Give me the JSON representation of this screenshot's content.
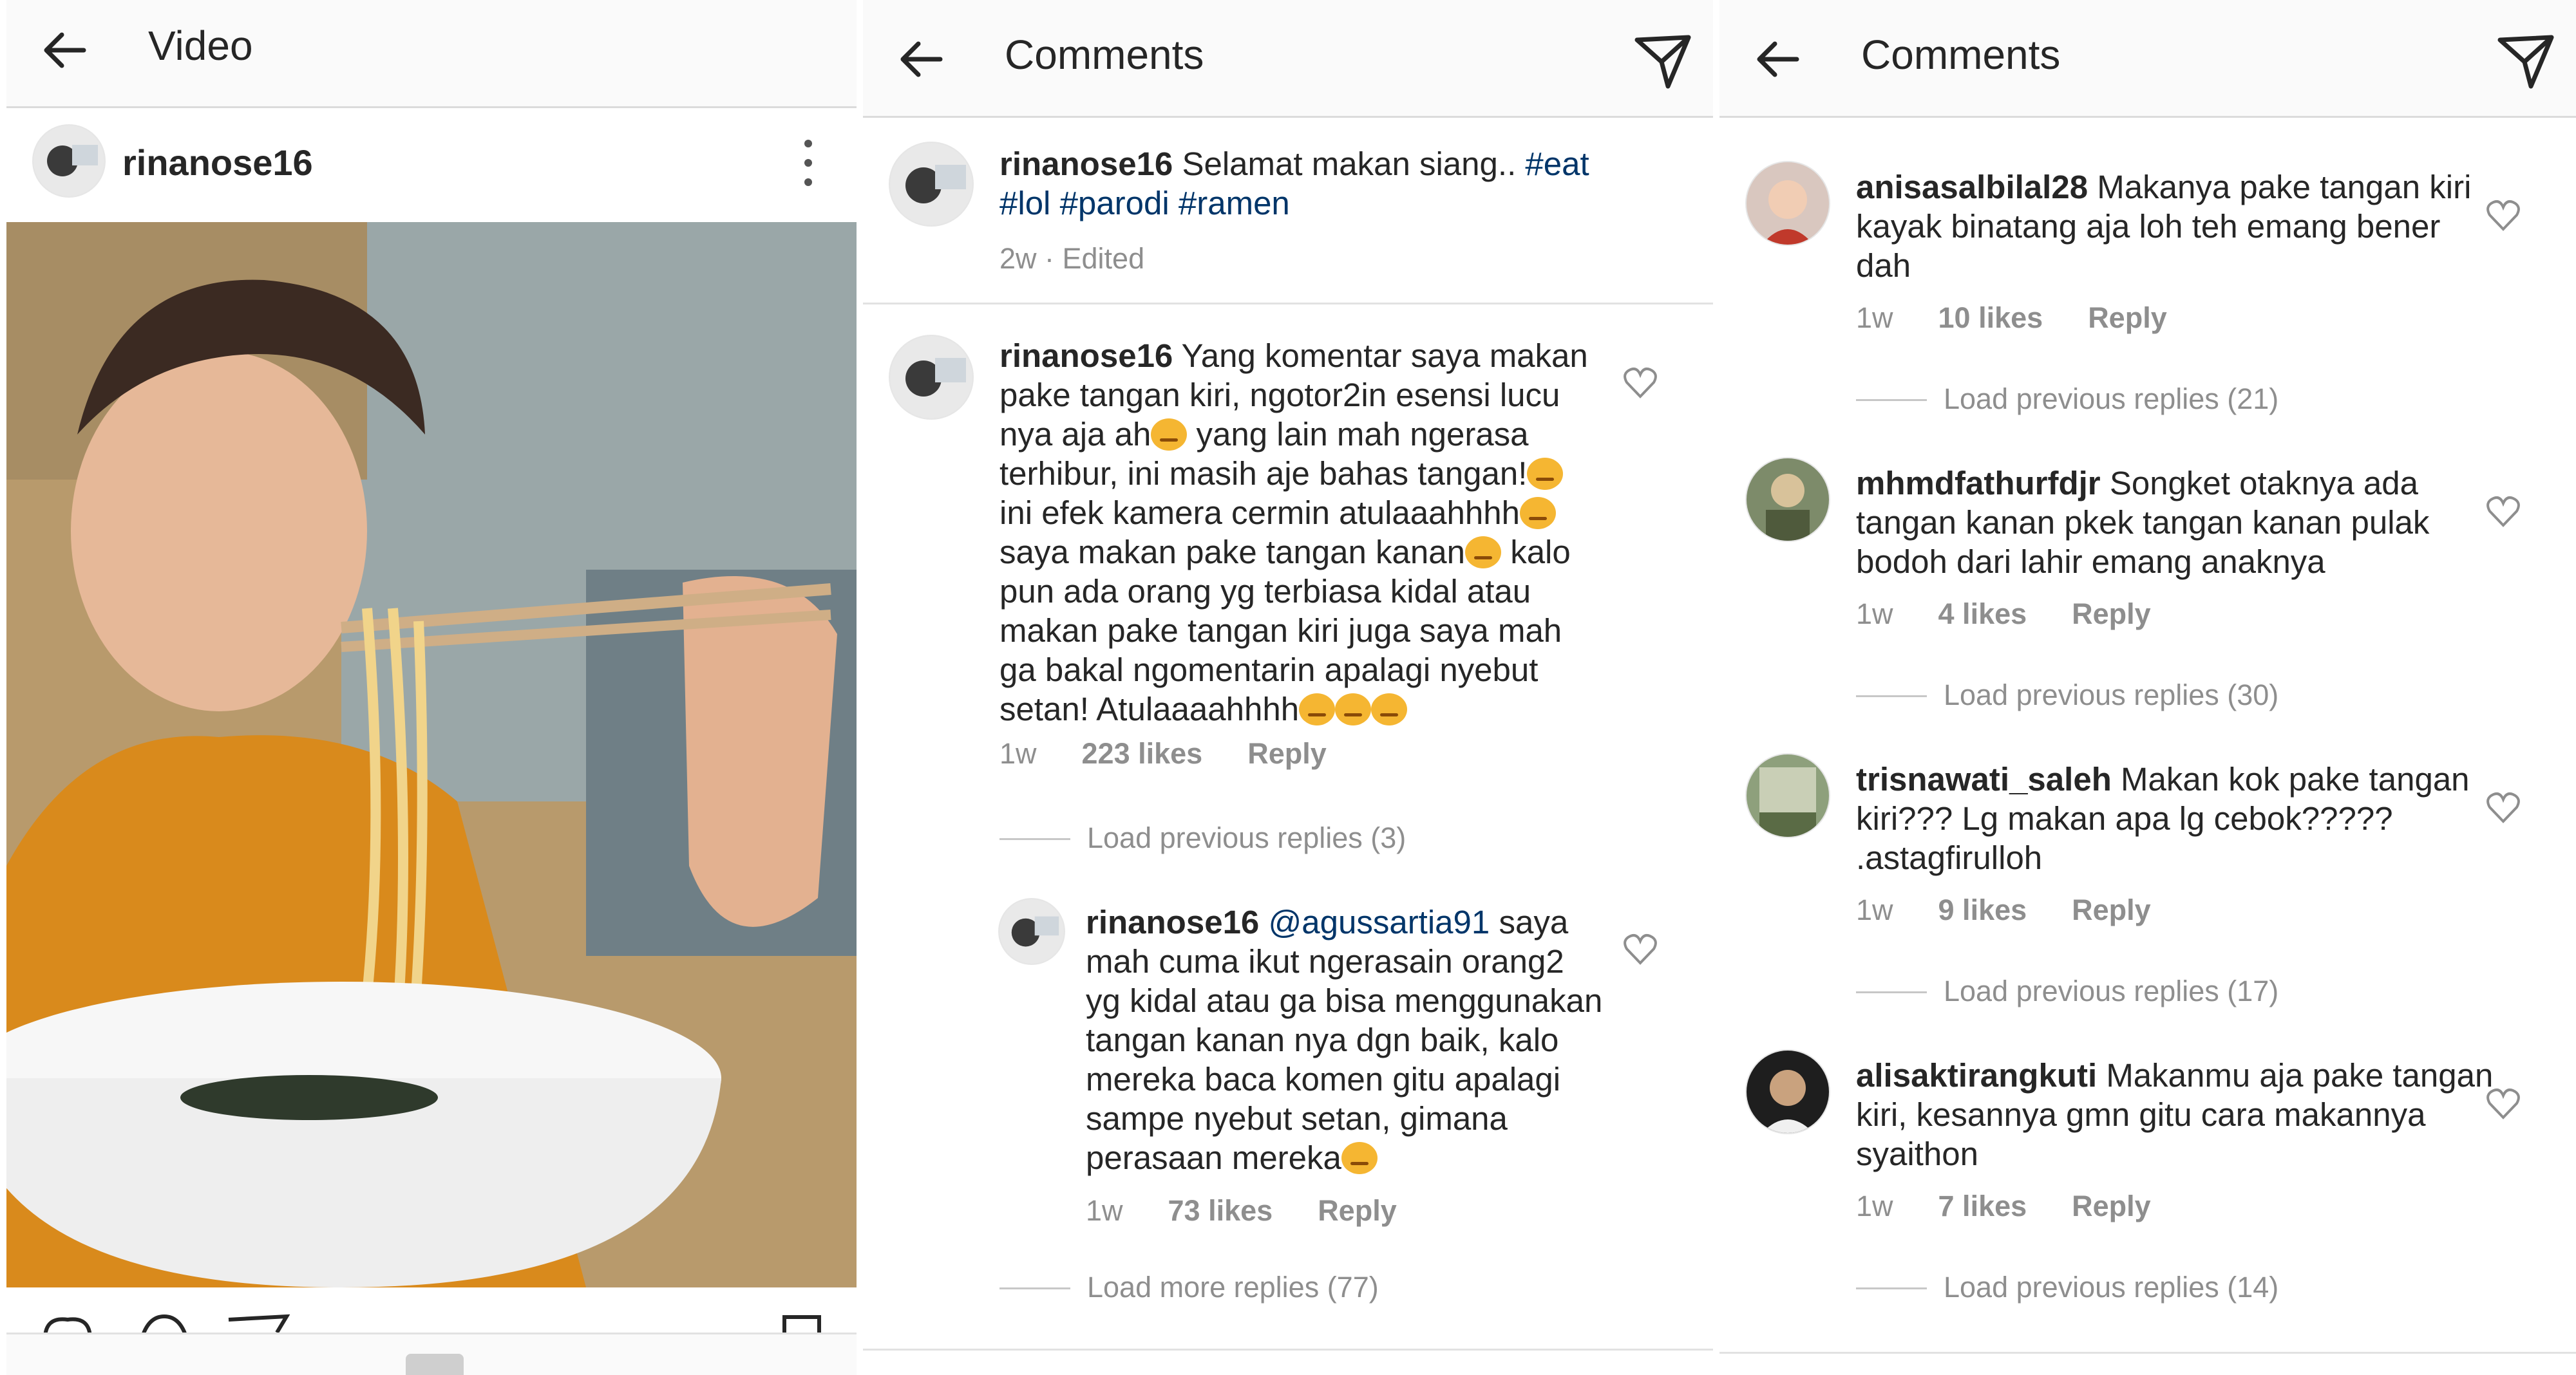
{
  "panel1": {
    "title": "Video",
    "post_user": "rinanose16"
  },
  "panel2": {
    "title": "Comments",
    "caption": {
      "user": "rinanose16",
      "text": "Selamat makan siang..",
      "hashtags": [
        "#eat",
        "#lol",
        "#parodi",
        "#ramen"
      ],
      "meta": "2w · Edited"
    },
    "comment1": {
      "user": "rinanose16",
      "lines": [
        "Yang komentar saya makan",
        "pake tangan kiri, ngotor2in esensi lucu",
        "nya aja ah",
        "yang lain mah ngerasa",
        "terhibur, ini masih aje bahas tangan!",
        "ini efek kamera cermin atulaaahhhh",
        "saya makan pake tangan kanan",
        "kalo",
        "pun ada orang yg terbiasa kidal atau",
        "makan pake tangan kiri juga saya mah",
        "ga bakal ngomentarin apalagi nyebut",
        "setan! Atulaaaahhhh"
      ],
      "time": "1w",
      "likes": "223 likes",
      "reply": "Reply"
    },
    "load_prev": "Load previous replies (3)",
    "reply1": {
      "user": "rinanose16",
      "mention": "@agussartia91",
      "lines": [
        "saya",
        "mah cuma ikut ngerasain orang2",
        "yg kidal atau ga bisa menggunakan",
        "tangan kanan nya dgn baik, kalo",
        "mereka baca komen gitu apalagi",
        "sampe nyebut setan, gimana",
        "perasaan mereka"
      ],
      "time": "1w",
      "likes": "73 likes",
      "reply": "Reply"
    },
    "load_more": "Load more replies (77)"
  },
  "panel3": {
    "title": "Comments",
    "comments": [
      {
        "user": "anisasalbilal28",
        "text": "Makanya pake tangan kiri kayak binatang aja loh teh emang bener dah",
        "time": "1w",
        "likes": "10 likes",
        "reply": "Reply",
        "load_prev": "Load previous replies (21)"
      },
      {
        "user": "mhmdfathurfdjr",
        "text": "Songket otaknya ada tangan kanan pkek tangan kanan pulak bodoh dari lahir emang anaknya",
        "time": "1w",
        "likes": "4 likes",
        "reply": "Reply",
        "load_prev": "Load previous replies (30)"
      },
      {
        "user": "trisnawati_saleh",
        "text": "Makan kok pake tangan kiri??? Lg makan apa lg cebok????? .astagfirulloh",
        "time": "1w",
        "likes": "9 likes",
        "reply": "Reply",
        "load_prev": "Load previous replies (17)"
      },
      {
        "user": "alisaktirangkuti",
        "text": "Makanmu aja pake tangan kiri, kesannya gmn gitu cara makannya syaithon",
        "time": "1w",
        "likes": "7 likes",
        "reply": "Reply",
        "load_prev": "Load previous replies (14)"
      }
    ]
  },
  "icons": {
    "back": "arrow-left-icon",
    "send": "paper-plane-icon",
    "like": "heart-outline-icon",
    "more": "vertical-dots-icon"
  },
  "colors": {
    "link": "#003569",
    "secondary": "#8e8e8e",
    "text": "#262626",
    "sweater": "#d98a1c"
  }
}
